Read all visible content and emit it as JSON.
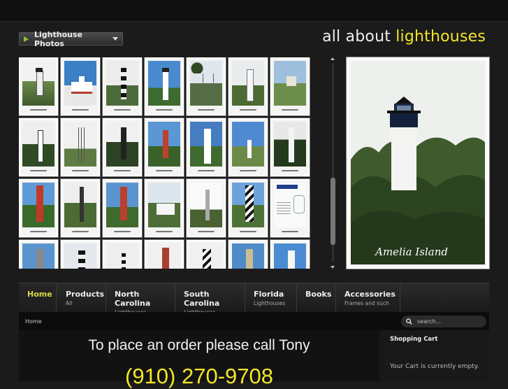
{
  "header": {
    "dropdown_label": "Lighthouse Photos",
    "tagline_prefix": "all about ",
    "tagline_accent": "lighthouses",
    "accent_color": "#f2e528"
  },
  "gallery": {
    "thumbnail_count": 28
  },
  "feature": {
    "caption": "Amelia Island"
  },
  "nav": {
    "items": [
      {
        "title": "Home",
        "sub": ""
      },
      {
        "title": "Products",
        "sub": "All"
      },
      {
        "title": "North Carolina",
        "sub": "Lighthouses"
      },
      {
        "title": "South Carolina",
        "sub": "Lighthouses"
      },
      {
        "title": "Florida",
        "sub": "Lighthouses"
      },
      {
        "title": "Books",
        "sub": ""
      },
      {
        "title": "Accessories",
        "sub": "Frames and such"
      }
    ]
  },
  "breadcrumb": "Home",
  "search": {
    "placeholder": "search..."
  },
  "content": {
    "order_line": "To place an order please call Tony",
    "phone": "(910) 270-9708"
  },
  "cart": {
    "title": "Shopping Cart",
    "empty_text": "Your Cart is currently empty."
  }
}
